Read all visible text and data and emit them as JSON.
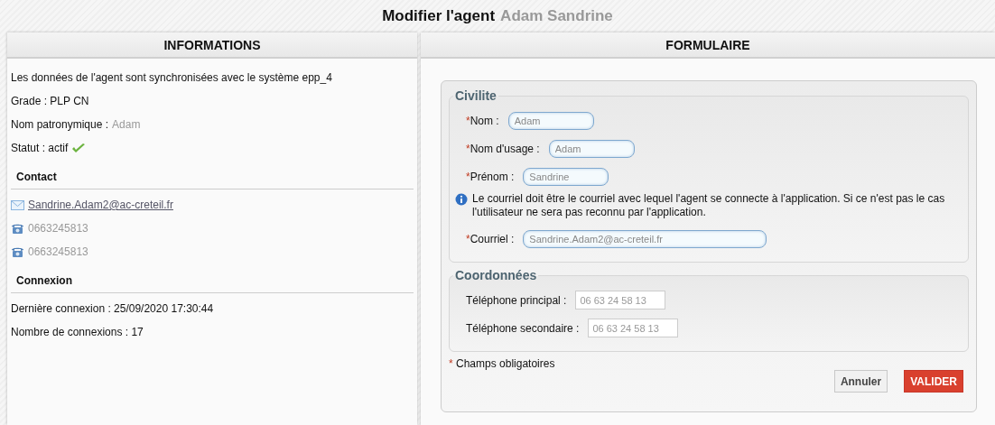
{
  "page_title": {
    "text": "Modifier l'agent",
    "name": "Adam Sandrine"
  },
  "informations": {
    "heading": "INFORMATIONS",
    "lines": [
      {
        "label": "Les données de l'agent sont synchronisées avec le système epp_4"
      },
      {
        "label": "Grade : PLP CN"
      },
      {
        "label": "Nom patronymique :",
        "value": "Adam"
      },
      {
        "label": "Statut : actif",
        "active": true
      }
    ],
    "sections": [
      {
        "title": "Contact",
        "items": [
          {
            "kind": "email",
            "text": "Sandrine.Adam2@ac-creteil.fr"
          },
          {
            "kind": "phone",
            "text": "0663245813"
          },
          {
            "kind": "phone",
            "text": "0663245813"
          }
        ]
      },
      {
        "title": "Connexion",
        "items": [
          {
            "kind": "text",
            "text": "Dernière connexion : 25/09/2020 17:30:44"
          },
          {
            "kind": "text",
            "text": "Nombre de connexions : 17"
          }
        ]
      }
    ]
  },
  "formulaire": {
    "heading": "FORMULAIRE",
    "fieldsets": [
      {
        "legend": "Civilite",
        "fields": [
          {
            "kind": "input",
            "mark": "*",
            "label": "Nom :",
            "value": "Adam"
          },
          {
            "kind": "input",
            "mark": "*",
            "label": "Nom d'usage :",
            "value": "Adam"
          },
          {
            "kind": "input",
            "mark": "*",
            "label": "Prénom :",
            "value": "Sandrine"
          },
          {
            "kind": "info",
            "text": "Le courriel doit être le courriel avec lequel l'agent se connecte à l'application. Si ce n'est pas le cas l'utilisateur ne sera pas reconnu par l'application."
          },
          {
            "kind": "input",
            "mark": "*",
            "label": "Courriel :",
            "value": "Sandrine.Adam2@ac-creteil.fr",
            "wide": true
          }
        ]
      },
      {
        "legend": "Coordonnées",
        "fields": [
          {
            "kind": "phone",
            "label": "Téléphone principal :",
            "value": "06 63 24 58 13"
          },
          {
            "kind": "phone",
            "label": "Téléphone secondaire :",
            "value": "06 63 24 58 13"
          }
        ]
      }
    ],
    "required_note": {
      "mark": "*",
      "text": "Champs obligatoires"
    },
    "buttons": [
      {
        "kind": "secondary",
        "label": "Annuler"
      },
      {
        "kind": "primary",
        "label": "VALIDER"
      }
    ]
  }
}
